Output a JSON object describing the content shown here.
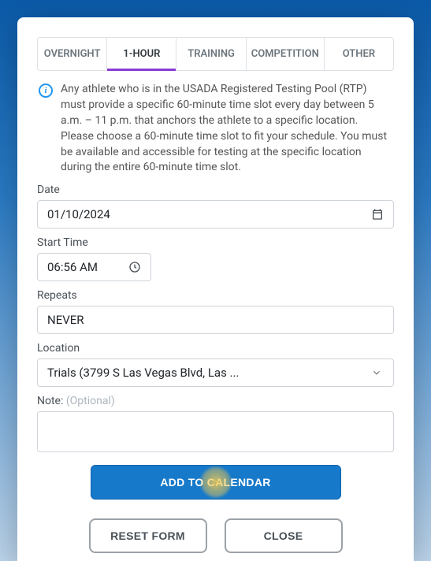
{
  "tabs": {
    "overnight": "OVERNIGHT",
    "one_hour": "1-HOUR",
    "training": "TRAINING",
    "competition": "COMPETITION",
    "other": "OTHER"
  },
  "info_text": "Any athlete who is in the USADA Registered Testing Pool (RTP) must provide a specific 60-minute time slot every day between 5 a.m. – 11 p.m. that anchors the athlete to a specific location. Please choose a 60-minute time slot to fit your schedule. You must be available and accessible for testing at the specific location during the entire 60-minute time slot.",
  "labels": {
    "date": "Date",
    "start_time": "Start Time",
    "repeats": "Repeats",
    "location": "Location",
    "note": "Note:",
    "note_hint": " (Optional)"
  },
  "values": {
    "date": "01/10/2024",
    "time": "06:56 AM",
    "repeats": "NEVER",
    "location": "Trials (3799 S Las Vegas Blvd, Las ...",
    "note": ""
  },
  "buttons": {
    "add": "ADD TO CALENDAR",
    "reset": "RESET FORM",
    "close": "CLOSE"
  }
}
